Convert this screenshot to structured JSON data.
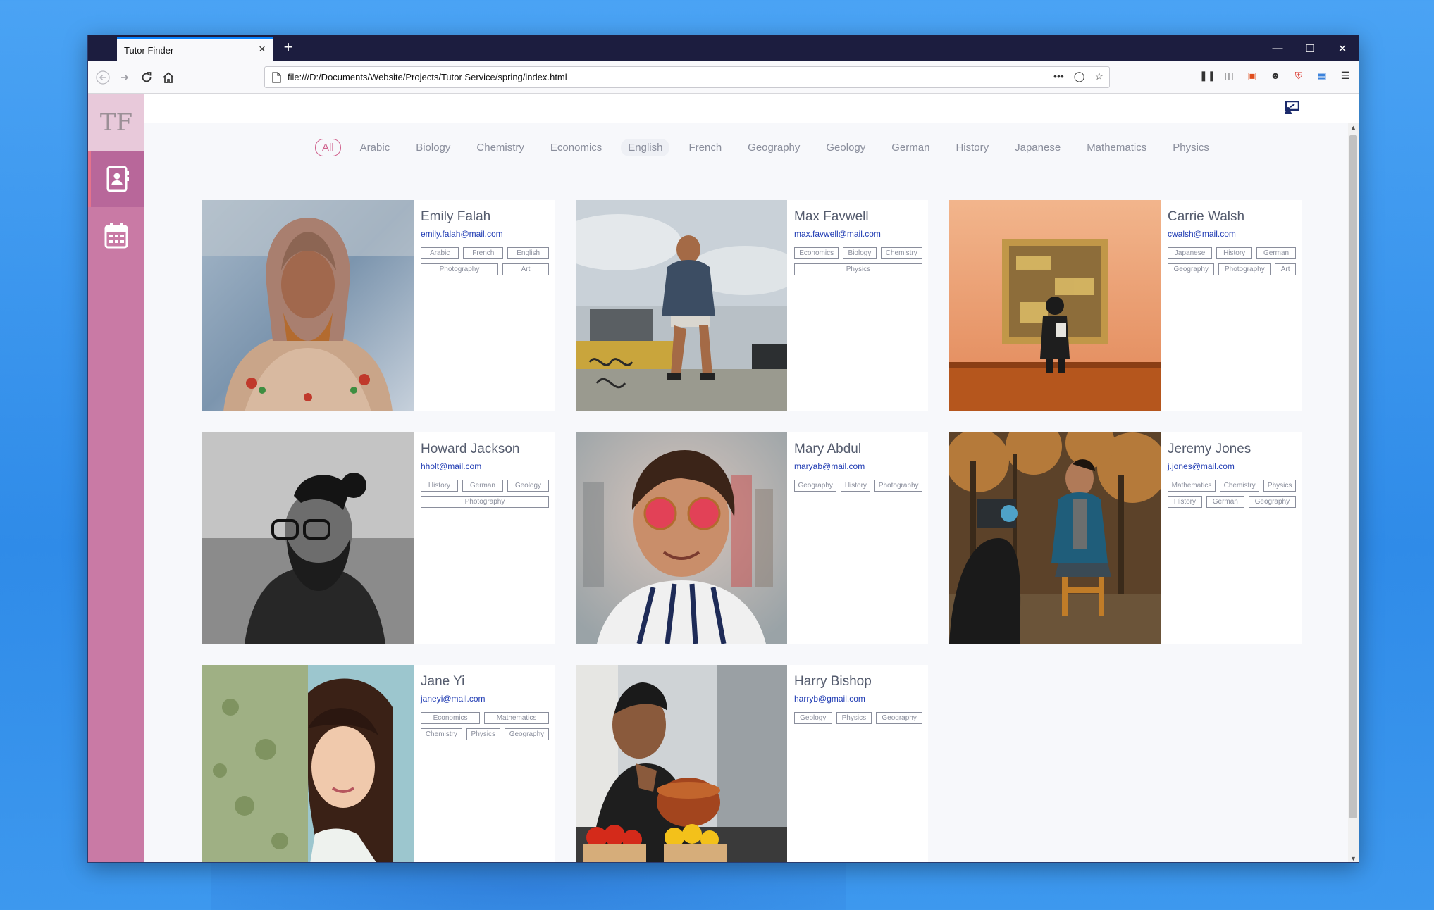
{
  "browser": {
    "tab_title": "Tutor Finder",
    "url": "file:///D:/Documents/Website/Projects/Tutor Service/spring/index.html"
  },
  "app": {
    "logo": "TF"
  },
  "filters": [
    "All",
    "Arabic",
    "Biology",
    "Chemistry",
    "Economics",
    "English",
    "French",
    "Geography",
    "Geology",
    "German",
    "History",
    "Japanese",
    "Mathematics",
    "Physics"
  ],
  "active_filter": "All",
  "tutors": [
    {
      "name": "Emily Falah",
      "email": "emily.falah@mail.com",
      "tags": [
        "Arabic",
        "French",
        "English",
        "Photography",
        "Art"
      ]
    },
    {
      "name": "Max Favwell",
      "email": "max.favwell@mail.com",
      "tags": [
        "Economics",
        "Biology",
        "Chemistry",
        "Physics"
      ]
    },
    {
      "name": "Carrie Walsh",
      "email": "cwalsh@mail.com",
      "tags": [
        "Japanese",
        "History",
        "German",
        "Geography",
        "Photography",
        "Art"
      ]
    },
    {
      "name": "Howard Jackson",
      "email": "hholt@mail.com",
      "tags": [
        "History",
        "German",
        "Geology",
        "Photography"
      ]
    },
    {
      "name": "Mary Abdul",
      "email": "maryab@mail.com",
      "tags": [
        "Geography",
        "History",
        "Photography"
      ]
    },
    {
      "name": "Jeremy Jones",
      "email": "j.jones@mail.com",
      "tags": [
        "Mathematics",
        "Chemistry",
        "Physics",
        "History",
        "German",
        "Geography"
      ]
    },
    {
      "name": "Jane Yi",
      "email": "janeyi@mail.com",
      "tags": [
        "Economics",
        "Mathematics",
        "Chemistry",
        "Physics",
        "Geography"
      ]
    },
    {
      "name": "Harry Bishop",
      "email": "harryb@gmail.com",
      "tags": [
        "Geology",
        "Physics",
        "Geography"
      ]
    }
  ],
  "colors": {
    "sidebar": "#c97aa5",
    "accent": "#d0648f",
    "email": "#1f3bb3"
  }
}
